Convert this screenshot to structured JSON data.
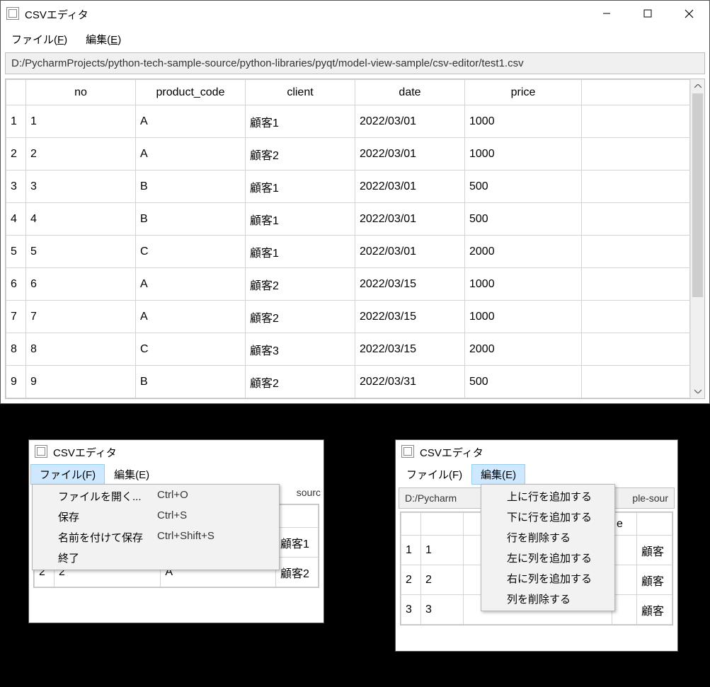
{
  "main": {
    "title": "CSVエディタ",
    "menubar": {
      "file": "ファイル(",
      "file_u": "F",
      "file_end": ")",
      "edit": "編集(",
      "edit_u": "E",
      "edit_end": ")"
    },
    "filepath": "D:/PycharmProjects/python-tech-sample-source/python-libraries/pyqt/model-view-sample/csv-editor/test1.csv",
    "columns": [
      "no",
      "product_code",
      "client",
      "date",
      "price"
    ],
    "rows": [
      {
        "h": "1",
        "c": [
          "1",
          "A",
          "顧客1",
          "2022/03/01",
          "1000"
        ]
      },
      {
        "h": "2",
        "c": [
          "2",
          "A",
          "顧客2",
          "2022/03/01",
          "1000"
        ]
      },
      {
        "h": "3",
        "c": [
          "3",
          "B",
          "顧客1",
          "2022/03/01",
          "500"
        ]
      },
      {
        "h": "4",
        "c": [
          "4",
          "B",
          "顧客1",
          "2022/03/01",
          "500"
        ]
      },
      {
        "h": "5",
        "c": [
          "5",
          "C",
          "顧客1",
          "2022/03/01",
          "2000"
        ]
      },
      {
        "h": "6",
        "c": [
          "6",
          "A",
          "顧客2",
          "2022/03/15",
          "1000"
        ]
      },
      {
        "h": "7",
        "c": [
          "7",
          "A",
          "顧客2",
          "2022/03/15",
          "1000"
        ]
      },
      {
        "h": "8",
        "c": [
          "8",
          "C",
          "顧客3",
          "2022/03/15",
          "2000"
        ]
      },
      {
        "h": "9",
        "c": [
          "9",
          "B",
          "顧客2",
          "2022/03/31",
          "500"
        ]
      }
    ]
  },
  "file_snippet": {
    "title": "CSVエディタ",
    "menu_file": "ファイル(F)",
    "menu_edit": "編集(E)",
    "items": [
      {
        "label": "ファイルを開く...",
        "accel": "Ctrl+O"
      },
      {
        "label": "保存",
        "accel": "Ctrl+S"
      },
      {
        "label": "名前を付けて保存",
        "accel": "Ctrl+Shift+S"
      },
      {
        "label": "終了",
        "accel": ""
      }
    ],
    "bg_text_right": "sourc",
    "bg_cell_1": "顧客1",
    "bg_cell_2_h": "2",
    "bg_cell_2_no": "2",
    "bg_cell_2_pc": "A",
    "bg_cell_2_cl": "顧客2"
  },
  "edit_snippet": {
    "title": "CSVエディタ",
    "menu_file": "ファイル(F)",
    "menu_edit": "編集(E)",
    "filepath_frag": "D:/Pycharm",
    "filepath_frag_right": "ple-sour",
    "items": [
      "上に行を追加する",
      "下に行を追加する",
      "行を削除する",
      "左に列を追加する",
      "右に列を追加する",
      "列を削除する"
    ],
    "bg_col_right": "e",
    "bg_cell_r1": "顧客",
    "bg_cell_r2": "顧客",
    "bg_cell_r3": "顧客",
    "rows": [
      {
        "h": "1",
        "no": "1"
      },
      {
        "h": "2",
        "no": "2"
      },
      {
        "h": "3",
        "no": "3"
      }
    ]
  }
}
